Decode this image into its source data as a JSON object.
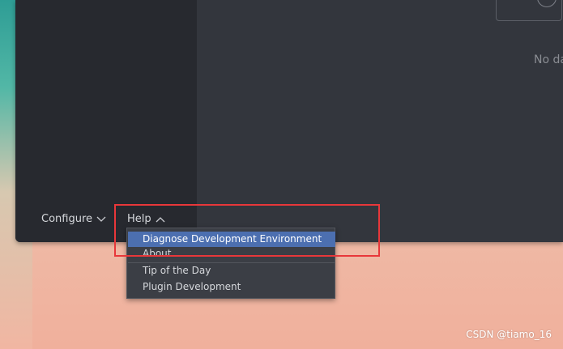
{
  "content": {
    "empty_text": "No da"
  },
  "footer": {
    "configure_label": "Configure",
    "help_label": "Help"
  },
  "help_menu": {
    "items": [
      {
        "label": "Diagnose Development Environment",
        "selected": true
      },
      {
        "label": "About",
        "selected": false
      },
      {
        "label": "Tip of the Day",
        "selected": false
      },
      {
        "label": "Plugin Development",
        "selected": false
      }
    ]
  },
  "watermark": "CSDN @tiamo_16",
  "colors": {
    "window_bg": "#2f3136",
    "sidebar_bg": "#27292f",
    "menu_bg": "#3b3e45",
    "menu_selected": "#4c6fb0",
    "highlight_box": "#e8373a"
  },
  "icons": {
    "configure": "chevron-down-icon",
    "help": "chevron-up-icon"
  }
}
